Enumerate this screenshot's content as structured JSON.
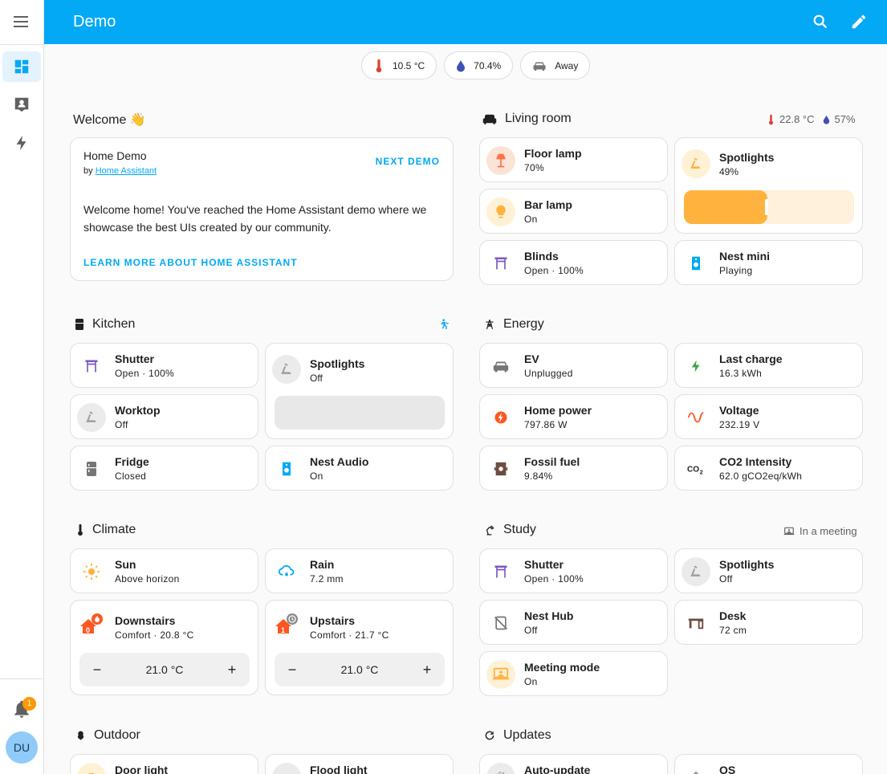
{
  "app": {
    "title": "Demo",
    "sidebar": {
      "items": [
        {
          "name": "overview",
          "icon": "dashboard-icon",
          "active": true
        },
        {
          "name": "map",
          "icon": "person-card-icon",
          "active": false
        },
        {
          "name": "energy",
          "icon": "lightning-icon",
          "active": false
        }
      ],
      "notifications_count": "1",
      "user_initials": "DU"
    }
  },
  "badges": [
    {
      "icon": "thermometer-icon",
      "label": "10.5 °C",
      "color": "#db4437"
    },
    {
      "icon": "water-drop-icon",
      "label": "70.4%",
      "color": "#3f51b5"
    },
    {
      "icon": "car-icon",
      "label": "Away",
      "color": "#757575"
    }
  ],
  "welcome": {
    "heading": "Welcome 👋",
    "card_title": "Home Demo",
    "by_prefix": "by",
    "by_link": "Home Assistant",
    "next": "NEXT DEMO",
    "body": "Welcome home! You've reached the Home Assistant demo where we showcase the best UIs created by our community.",
    "learn_more": "LEARN MORE ABOUT HOME ASSISTANT"
  },
  "living_room": {
    "heading": "Living room",
    "temp": "22.8 °C",
    "humidity": "57%",
    "floor_lamp": {
      "name": "Floor lamp",
      "state": "70%"
    },
    "bar_lamp": {
      "name": "Bar lamp",
      "state": "On"
    },
    "blinds": {
      "name": "Blinds",
      "state": "Open · 100%"
    },
    "spotlights": {
      "name": "Spotlights",
      "state": "49%",
      "level": 0.49
    },
    "nest_mini": {
      "name": "Nest mini",
      "state": "Playing"
    }
  },
  "kitchen": {
    "heading": "Kitchen",
    "shutter": {
      "name": "Shutter",
      "state": "Open · 100%"
    },
    "worktop": {
      "name": "Worktop",
      "state": "Off"
    },
    "fridge": {
      "name": "Fridge",
      "state": "Closed"
    },
    "spotlights": {
      "name": "Spotlights",
      "state": "Off"
    },
    "nest_audio": {
      "name": "Nest Audio",
      "state": "On"
    }
  },
  "energy": {
    "heading": "Energy",
    "ev": {
      "name": "EV",
      "state": "Unplugged"
    },
    "home_power": {
      "name": "Home power",
      "state": "797.86 W"
    },
    "fossil_fuel": {
      "name": "Fossil fuel",
      "state": "9.84%"
    },
    "last_charge": {
      "name": "Last charge",
      "state": "16.3 kWh"
    },
    "voltage": {
      "name": "Voltage",
      "state": "232.19 V"
    },
    "co2": {
      "name": "CO2 Intensity",
      "state": "62.0 gCO2eq/kWh"
    }
  },
  "climate": {
    "heading": "Climate",
    "sun": {
      "name": "Sun",
      "state": "Above horizon"
    },
    "rain": {
      "name": "Rain",
      "state": "7.2 mm"
    },
    "downstairs": {
      "name": "Downstairs",
      "state": "Comfort · 20.8 °C",
      "target": "21.0 °C"
    },
    "upstairs": {
      "name": "Upstairs",
      "state": "Comfort · 21.7 °C",
      "target": "21.0 °C"
    }
  },
  "study": {
    "heading": "Study",
    "status": "In a meeting",
    "shutter": {
      "name": "Shutter",
      "state": "Open · 100%"
    },
    "nest_hub": {
      "name": "Nest Hub",
      "state": "Off"
    },
    "meeting_mode": {
      "name": "Meeting mode",
      "state": "On"
    },
    "spotlights": {
      "name": "Spotlights",
      "state": "Off"
    },
    "desk": {
      "name": "Desk",
      "state": "72 cm"
    }
  },
  "outdoor": {
    "heading": "Outdoor",
    "door_light": {
      "name": "Door light"
    },
    "flood_light": {
      "name": "Flood light"
    }
  },
  "updates": {
    "heading": "Updates",
    "auto_update": {
      "name": "Auto-update"
    },
    "os": {
      "name": "OS"
    }
  },
  "colors": {
    "accent": "#03a9f4",
    "light_on": "#ffb33e",
    "purple": "#7e57c2",
    "red_orange": "#ff5722"
  }
}
